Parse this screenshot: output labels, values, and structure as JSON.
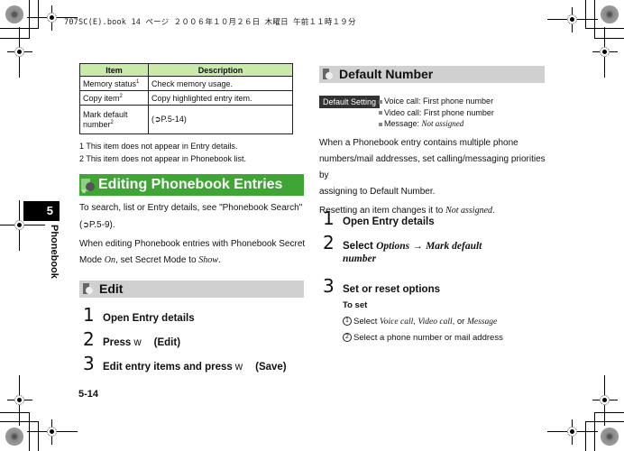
{
  "print_header": "707SC(E).book  14 ページ  ２００６年１０月２６日  木曜日  午前１１時１９分",
  "side_tab": {
    "chapter_number": "5",
    "chapter_label": "Phonebook"
  },
  "page_number": "5-14",
  "options_table": {
    "headers": [
      "Item",
      "Description"
    ],
    "rows": [
      {
        "item": "Memory status",
        "sup": "1",
        "description": "Check memory usage."
      },
      {
        "item": "Copy item",
        "sup": "2",
        "description": "Copy highlighted entry item."
      },
      {
        "item": "Mark default number",
        "sup": "2",
        "description": "P.5-14)",
        "ref_prefix": "("
      }
    ]
  },
  "footnotes": [
    "1 This item does not appear in Entry details.",
    "2 This item does not appear in Phonebook list."
  ],
  "editing_section": {
    "title": "Editing Phonebook Entries",
    "intro_1": "To search, list or Entry details, see \"Phonebook Search\"",
    "intro_1_ref": "P.5-9).",
    "intro_2_a": "When editing Phonebook entries with Phonebook Secret",
    "intro_2_b": "Mode ",
    "intro_2_on": "On",
    "intro_2_c": ", set Secret Mode to ",
    "intro_2_show": "Show",
    "intro_2_d": "."
  },
  "edit_section": {
    "title": "Edit",
    "steps": [
      {
        "num": "1",
        "text": "Open Entry details"
      },
      {
        "num": "2",
        "text": "Press",
        "key": "w",
        "action": "(Edit)"
      },
      {
        "num": "3",
        "text": "Edit entry items and press",
        "key": "w",
        "action": "(Save)"
      }
    ]
  },
  "default_number_section": {
    "title": "Default Number",
    "default_setting_label": "Default Setting",
    "defaults": [
      {
        "label": "Voice call: First phone number"
      },
      {
        "label": "Video call: First phone number"
      },
      {
        "label": "Message: ",
        "value": "Not assigned"
      }
    ],
    "description_lines": [
      "When a Phonebook entry contains multiple phone",
      "numbers/mail addresses, set calling/messaging priorities by",
      "assigning to Default Number."
    ],
    "reset_note": "Resetting an item changes it to ",
    "reset_value": "Not assigned",
    "steps": [
      {
        "num": "1",
        "text": "Open Entry details"
      },
      {
        "num": "2",
        "text": "Select ",
        "opt1": "Options",
        "arrow": "→",
        "opt2": "Mark default",
        "opt2b": "number"
      },
      {
        "num": "3",
        "text": "Set or reset options"
      }
    ],
    "to_set_label": "To set",
    "to_set_steps": [
      {
        "circle": "1",
        "text": "Select ",
        "i1": "Voice call",
        "sep1": ", ",
        "i2": "Video call",
        "sep2": ", or ",
        "i3": "Message"
      },
      {
        "circle": "2",
        "text": "Select a phone number or mail address"
      }
    ]
  }
}
